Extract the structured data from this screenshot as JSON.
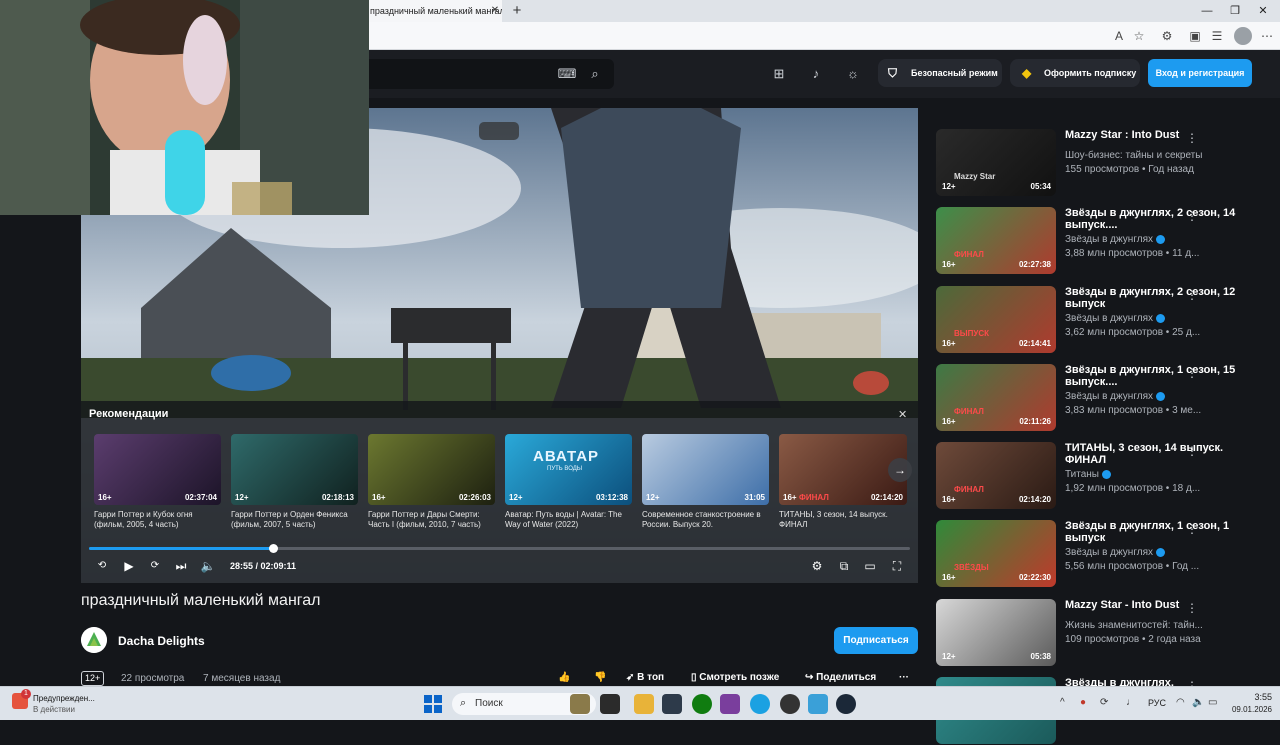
{
  "browser": {
    "tab_title": "праздничный маленький мангал",
    "tab_close": "✕",
    "new_tab": "+",
    "window_controls": [
      "—",
      "❐",
      "✕"
    ],
    "address_icons": [
      "read-aloud-icon",
      "star-icon",
      "extensions-icon",
      "split-screen-icon",
      "favorites-icon",
      "collections-icon"
    ]
  },
  "header": {
    "safe_mode": "Безопасный режим",
    "subscribe_offer": "Оформить подписку",
    "login": "Вход и регистрация"
  },
  "player": {
    "recommendations_title": "Рекомендации",
    "close": "✕",
    "time": "28:55 / 02:09:11",
    "progress": 0.224,
    "recommendations": [
      {
        "title": "Гарри Поттер и Кубок огня (фильм, 2005, 4 часть)",
        "age": "16+",
        "duration": "02:37:04",
        "color": "#5b3d6e",
        "color2": "#1c1428"
      },
      {
        "title": "Гарри Поттер и Орден Феникса (фильм, 2007, 5 часть)",
        "age": "12+",
        "duration": "02:18:13",
        "color": "#2f6a6a",
        "color2": "#10211f"
      },
      {
        "title": "Гарри Поттер и Дары Смерти: Часть I (фильм, 2010, 7 часть)",
        "age": "16+",
        "duration": "02:26:03",
        "color": "#6c7830",
        "color2": "#1d2010"
      },
      {
        "title": "Аватар: Путь воды | Avatar: The Way of Water (2022)",
        "age": "12+",
        "duration": "03:12:38",
        "color": "#2aa9d9",
        "color2": "#0c4f7c"
      },
      {
        "title": "Современное станкостроение в России. Выпуск 20.",
        "age": "12+",
        "duration": "31:05",
        "color": "#b9cbe0",
        "color2": "#3d6ea8"
      },
      {
        "title": "ТИТАНЫ, 3 сезон, 14 выпуск. ФИНАЛ",
        "age": "16+",
        "duration": "02:14:20",
        "color": "#8a5a45",
        "color2": "#3a1a14"
      }
    ],
    "avatar_text": "АВАТАР",
    "avatar_sub": "ПУТЬ ВОДЫ",
    "final_label": "ФИНАЛ"
  },
  "video": {
    "title": "праздничный маленький мангал",
    "channel": "Dacha Delights",
    "subscribe": "Подписаться",
    "age": "12+",
    "views": "22 просмотра",
    "date": "7 месяцев назад",
    "actions": {
      "to_top": "В топ",
      "watch_later": "Смотреть позже",
      "share": "Поделиться",
      "more": "···"
    }
  },
  "sidebar": [
    {
      "title": "Mazzy Star : Into Dust",
      "channel": "Шоу-бизнес: тайны и секреты",
      "stats": "155 просмотров • Год назад",
      "age": "12+",
      "duration": "05:34",
      "verified": false,
      "color": "#2a2a2a",
      "color2": "#111111",
      "thumb_label": "Mazzy Star"
    },
    {
      "title": "Звёзды в джунглях, 2 сезон, 14 выпуск....",
      "channel": "Звёзды в джунглях",
      "stats": "3,88 млн просмотров • 11 д...",
      "age": "16+",
      "duration": "02:27:38",
      "verified": true,
      "color": "#3c8f4a",
      "color2": "#b03a2e",
      "thumb_label": "ФИНАЛ"
    },
    {
      "title": "Звёзды в джунглях, 2 сезон, 12 выпуск",
      "channel": "Звёзды в джунглях",
      "stats": "3,62 млн просмотров • 25 д...",
      "age": "16+",
      "duration": "02:14:41",
      "verified": true,
      "color": "#4b6a3a",
      "color2": "#b03a2e",
      "thumb_label": "ВЫПУСК"
    },
    {
      "title": "Звёзды в джунглях, 1 сезон, 15 выпуск....",
      "channel": "Звёзды в джунглях",
      "stats": "3,83 млн просмотров • 3 ме...",
      "age": "16+",
      "duration": "02:11:26",
      "verified": true,
      "color": "#3d7a45",
      "color2": "#b03a2e",
      "thumb_label": "ФИНАЛ"
    },
    {
      "title": "ТИТАНЫ, 3 сезон, 14 выпуск. ФИНАЛ",
      "channel": "Титаны",
      "stats": "1,92 млн просмотров • 18 д...",
      "age": "16+",
      "duration": "02:14:20",
      "verified": true,
      "color": "#6e4a3a",
      "color2": "#2a1a14",
      "thumb_label": "ФИНАЛ"
    },
    {
      "title": "Звёзды в джунглях, 1 сезон, 1 выпуск",
      "channel": "Звёзды в джунглях",
      "stats": "5,56 млн просмотров • Год ...",
      "age": "16+",
      "duration": "02:22:30",
      "verified": true,
      "color": "#2f8a3a",
      "color2": "#c0392b",
      "thumb_label": "ЗВЁЗДЫ"
    },
    {
      "title": "Mazzy Star - Into Dust",
      "channel": "Жизнь знаменитостей: тайн...",
      "stats": "109 просмотров • 2 года наза...",
      "age": "12+",
      "duration": "05:38",
      "verified": false,
      "color": "#d8d8d8",
      "color2": "#5a5a5a",
      "thumb_label": ""
    },
    {
      "title": "Звёзды в джунглях,",
      "channel": "",
      "stats": "",
      "age": "",
      "duration": "",
      "verified": false,
      "color": "#2f8a8a",
      "color2": "#1b5a5a",
      "thumb_label": ""
    }
  ],
  "taskbar": {
    "notification_title": "Предупрежден...",
    "notification_sub": "В действии",
    "notification_badge": "1",
    "search": "Поиск",
    "lang": "РУС",
    "time": "3:55",
    "date": "09.01.2026"
  }
}
